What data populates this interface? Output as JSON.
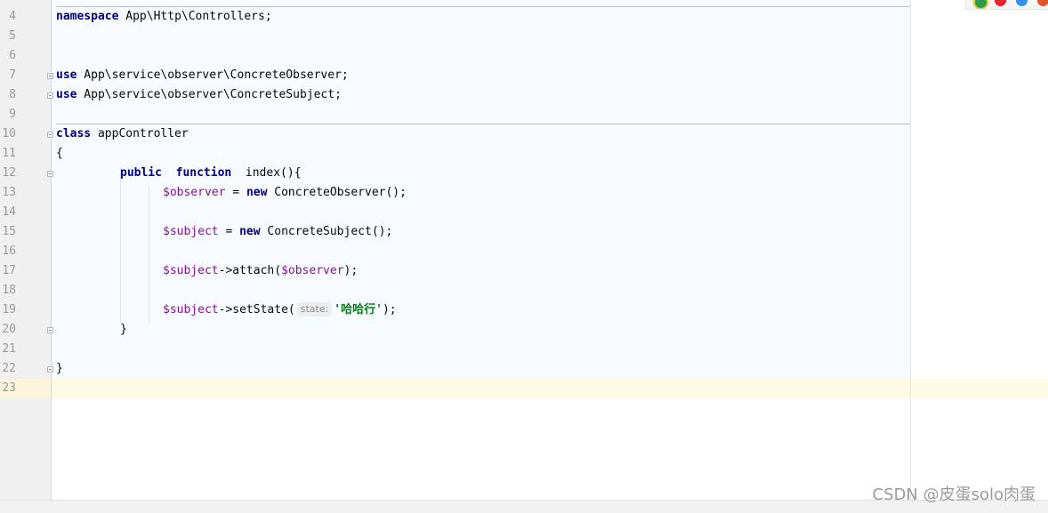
{
  "editor": {
    "line_numbers": [
      "4",
      "5",
      "6",
      "7",
      "8",
      "9",
      "10",
      "11",
      "12",
      "13",
      "14",
      "15",
      "16",
      "17",
      "18",
      "19",
      "20",
      "21",
      "22",
      "23"
    ],
    "current_line": "23"
  },
  "code": {
    "l4_kw": "namespace",
    "l4_rest": " App\\Http\\Controllers;",
    "l7_kw": "use",
    "l7_rest": " App\\service\\observer\\ConcreteObserver;",
    "l8_kw": "use",
    "l8_rest": " App\\service\\observer\\ConcreteSubject;",
    "l10_kw": "class",
    "l10_rest": " appController",
    "l11": "{",
    "l12_public": "public",
    "l12_function": "function",
    "l12_rest": "index(){",
    "l13_var": "$observer",
    "l13_eq": " = ",
    "l13_new": "new",
    "l13_rest": " ConcreteObserver();",
    "l15_var": "$subject",
    "l15_eq": " = ",
    "l15_new": "new",
    "l15_rest": " ConcreteSubject();",
    "l17_var": "$subject",
    "l17_mid": "->attach(",
    "l17_arg": "$observer",
    "l17_end": ");",
    "l19_var": "$subject",
    "l19_mid": "->setState(",
    "l19_hint": "state:",
    "l19_str": "'哈哈行'",
    "l19_end": ");",
    "l20": "}",
    "l22": "}"
  },
  "browser_icons": [
    "chrome-icon",
    "opera-icon",
    "edge-icon",
    "firefox-icon"
  ],
  "watermark": "CSDN @皮蛋solo肉蛋",
  "colors": {
    "keyword": "#000080",
    "variable": "#871094",
    "string": "#067d17",
    "code_background": "#f7faff",
    "current_line": "#fffae3",
    "gutter": "#f0f0f0"
  }
}
